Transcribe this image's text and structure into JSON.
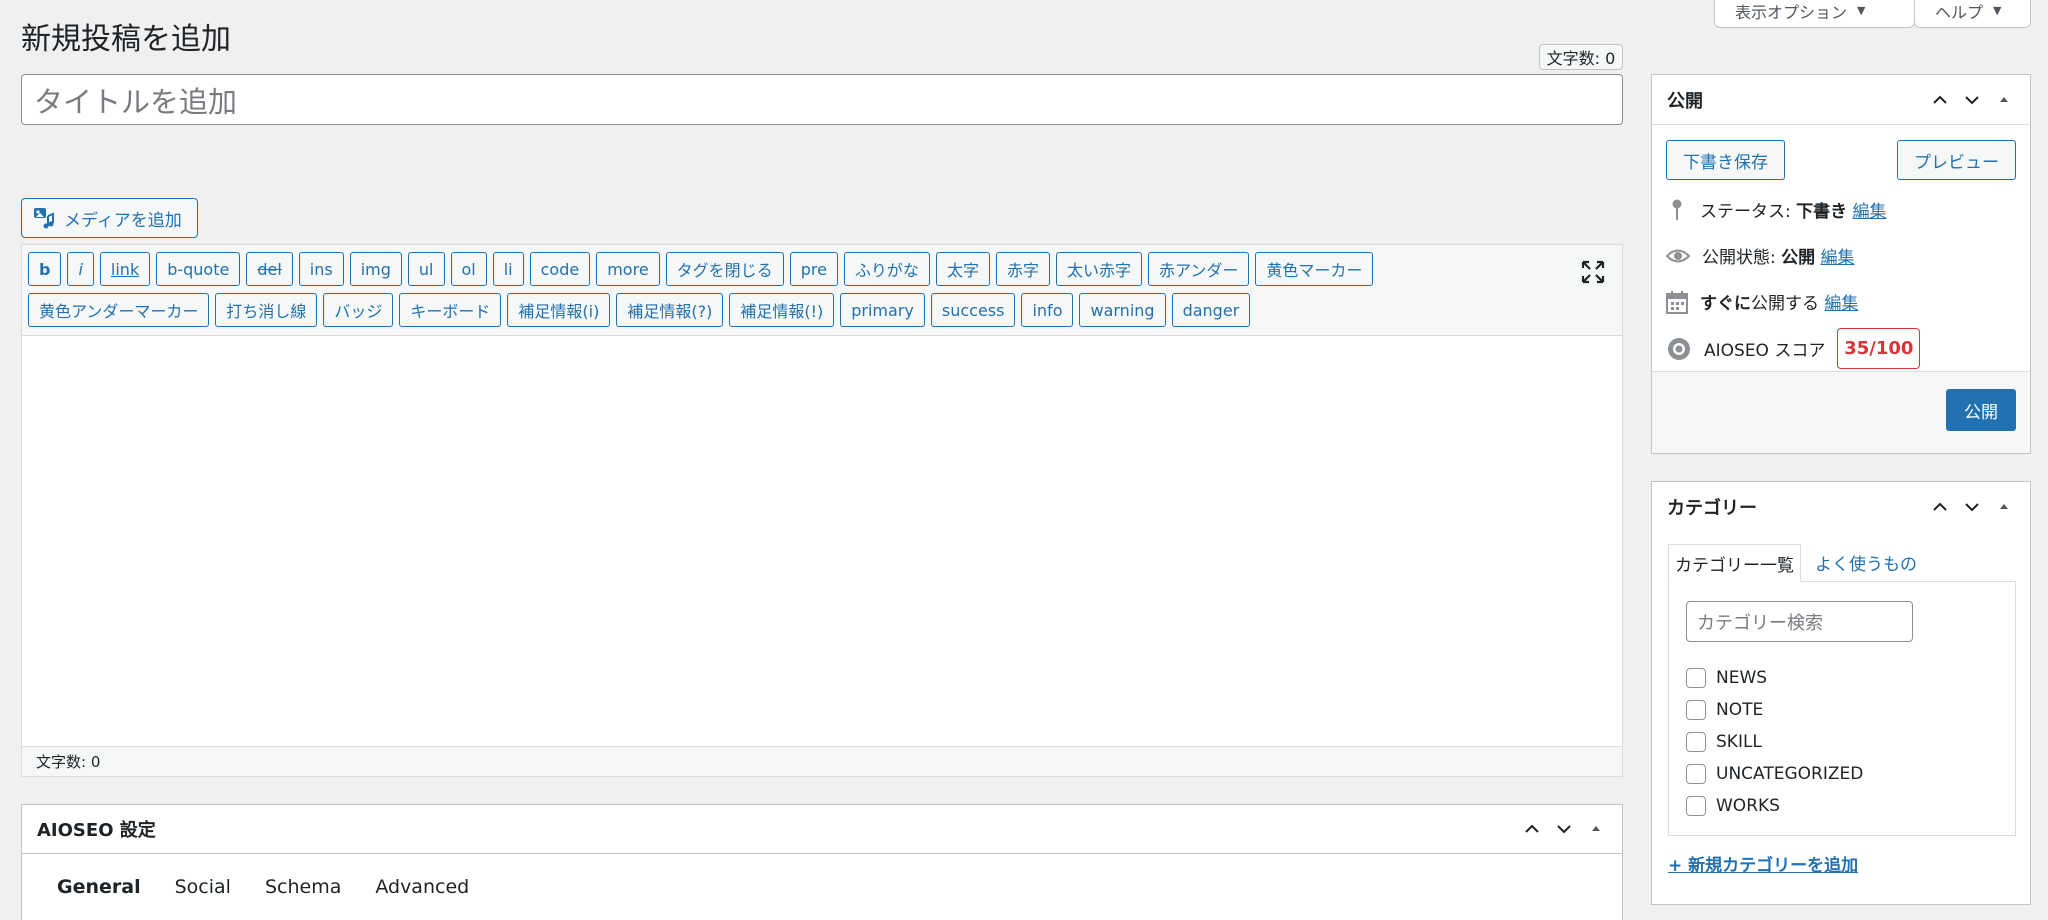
{
  "screen_options": {
    "display_label": "表示オプション",
    "help_label": "ヘルプ"
  },
  "page_title": "新規投稿を追加",
  "title_counter": "文字数: 0",
  "title_placeholder": "タイトルを追加",
  "media_button": "メディアを追加",
  "quicktags": {
    "row1": [
      "b",
      "i",
      "link",
      "b-quote",
      "del",
      "ins",
      "img",
      "ul",
      "ol",
      "li",
      "code",
      "more",
      "タグを閉じる",
      "pre",
      "ふりがな",
      "太字",
      "赤字",
      "太い赤字",
      "赤アンダー",
      "黄色マーカー"
    ],
    "row2": [
      "黄色アンダーマーカー",
      "打ち消し線",
      "バッジ",
      "キーボード",
      "補足情報(i)",
      "補足情報(?)",
      "補足情報(!)",
      "primary",
      "success",
      "info",
      "warning",
      "danger"
    ]
  },
  "editor_statusbar": "文字数: 0",
  "aioseo": {
    "title": "AIOSEO 設定",
    "tabs": [
      "General",
      "Social",
      "Schema",
      "Advanced"
    ],
    "active_tab": "General"
  },
  "publish": {
    "title": "公開",
    "save_draft": "下書き保存",
    "preview": "プレビュー",
    "status_label": "ステータス:",
    "status_value": "下書き",
    "visibility_label": "公開状態:",
    "visibility_value": "公開",
    "schedule_bold": "すぐに",
    "schedule_text": "公開する",
    "edit_link": "編集",
    "aioseo_score_label": "AIOSEO スコア",
    "aioseo_score": "35/100",
    "publish_button": "公開"
  },
  "categories": {
    "title": "カテゴリー",
    "tab_all": "カテゴリー一覧",
    "tab_popular": "よく使うもの",
    "search_placeholder": "カテゴリー検索",
    "items": [
      "NEWS",
      "NOTE",
      "SKILL",
      "UNCATEGORIZED",
      "WORKS"
    ],
    "add_new": "+ 新規カテゴリーを追加"
  },
  "colors": {
    "accent": "#2271b1",
    "score": "#d63638",
    "background": "#f0f0f1"
  }
}
